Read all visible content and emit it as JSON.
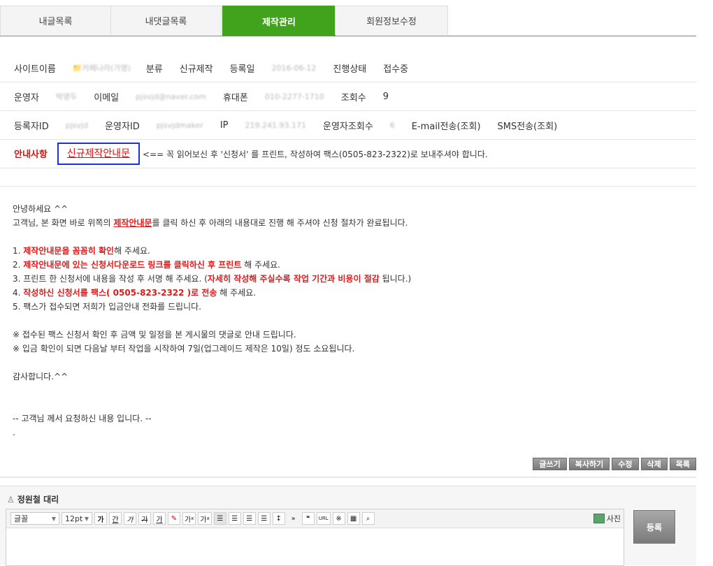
{
  "tabs": [
    {
      "label": "내글목록"
    },
    {
      "label": "내댓글목록"
    },
    {
      "label": "제작관리"
    },
    {
      "label": "회원정보수정"
    }
  ],
  "info": {
    "site_name_label": "사이트이름",
    "site_name_value": "카페나라(가명)",
    "category_label": "분류",
    "category_value": "신규제작",
    "reg_date_label": "등록일",
    "reg_date_value": "2016-06-12",
    "status_label": "진행상태",
    "status_value": "접수중",
    "operator_label": "운영자",
    "operator_value": "박영두",
    "email_label": "이메일",
    "email_value": "pjsvjd@naver.com",
    "phone_label": "휴대폰",
    "phone_value": "010-2277-1710",
    "views_label": "조회수",
    "views_value": "9",
    "reg_id_label": "등록자ID",
    "reg_id_value": "pjsvjd",
    "op_id_label": "운영자ID",
    "op_id_value": "pjsvjdmaker",
    "ip_label": "IP",
    "ip_value": "219.241.93.171",
    "op_views_label": "운영자조회수",
    "op_views_value": "6",
    "email_send": "E-mail전송(조회)",
    "sms_send": "SMS전송(조회)",
    "notice_label": "안내사항",
    "guide_link": "신규제작안내문",
    "notice_text": "<== 꼭 읽어보신 후 '신청서' 를 프린트, 작성하여 팩스(0505-823-2322)로 보내주셔야 합니다."
  },
  "content": {
    "greet": "안녕하세요 ^^",
    "l2a": "고객님, 본 화면 바로 위쪽의 ",
    "l2b": "제작안내문",
    "l2c": "를 클릭 하신 후 아래의 내용대로 진행 해 주셔야 신청 절차가 완료됩니다.",
    "s1a": "1. ",
    "s1b": "제작안내문을 꼼꼼히 확인",
    "s1c": "해 주세요.",
    "s2a": "2. ",
    "s2b": "제작안내문에 있는 신청서다운로드 링크를 클릭하신 후 프린트",
    "s2c": " 해 주세요.",
    "s3a": "3. 프린트 한 신청서에 내용을 작성 후 서명 해 주세요. (",
    "s3b": "자세히 작성해 주실수록 작업 기간과 비용이 절감",
    "s3c": " 됩니다.)",
    "s4a": "4. ",
    "s4b": "작성하신 신청서를 팩스( 0505-823-2322 )로 전송",
    "s4c": " 해 주세요.",
    "s5": "5. 팩스가 접수되면 저희가 입금안내 전화를 드립니다.",
    "n1": "※ 접수된 팩스 신청서 확인 후 금액 및 일정을 본 게시물의 댓글로 안내 드립니다.",
    "n2": "※ 입금 확인이 되면 다음날 부터 작업을 시작하여 7일(업그레이드 제작은 10일) 정도 소요됩니다.",
    "thanks": "감사합니다.^^",
    "request": "-- 고객님 께서 요청하신 내용 입니다. --",
    "dot": "."
  },
  "actions": {
    "write": "글쓰기",
    "copy": "복사하기",
    "edit": "수정",
    "delete": "삭제",
    "list": "목록"
  },
  "comment": {
    "author": "정원철 대리",
    "font_select": "글꼴",
    "size_select": "12pt",
    "bold": "가",
    "underline": "간",
    "italic": "가",
    "strike": "가",
    "fontcolor": "가",
    "sup": "가",
    "sub": "가",
    "quote": "❝",
    "url": "URL",
    "special": "※",
    "photo": "사진",
    "submit": "등록"
  }
}
